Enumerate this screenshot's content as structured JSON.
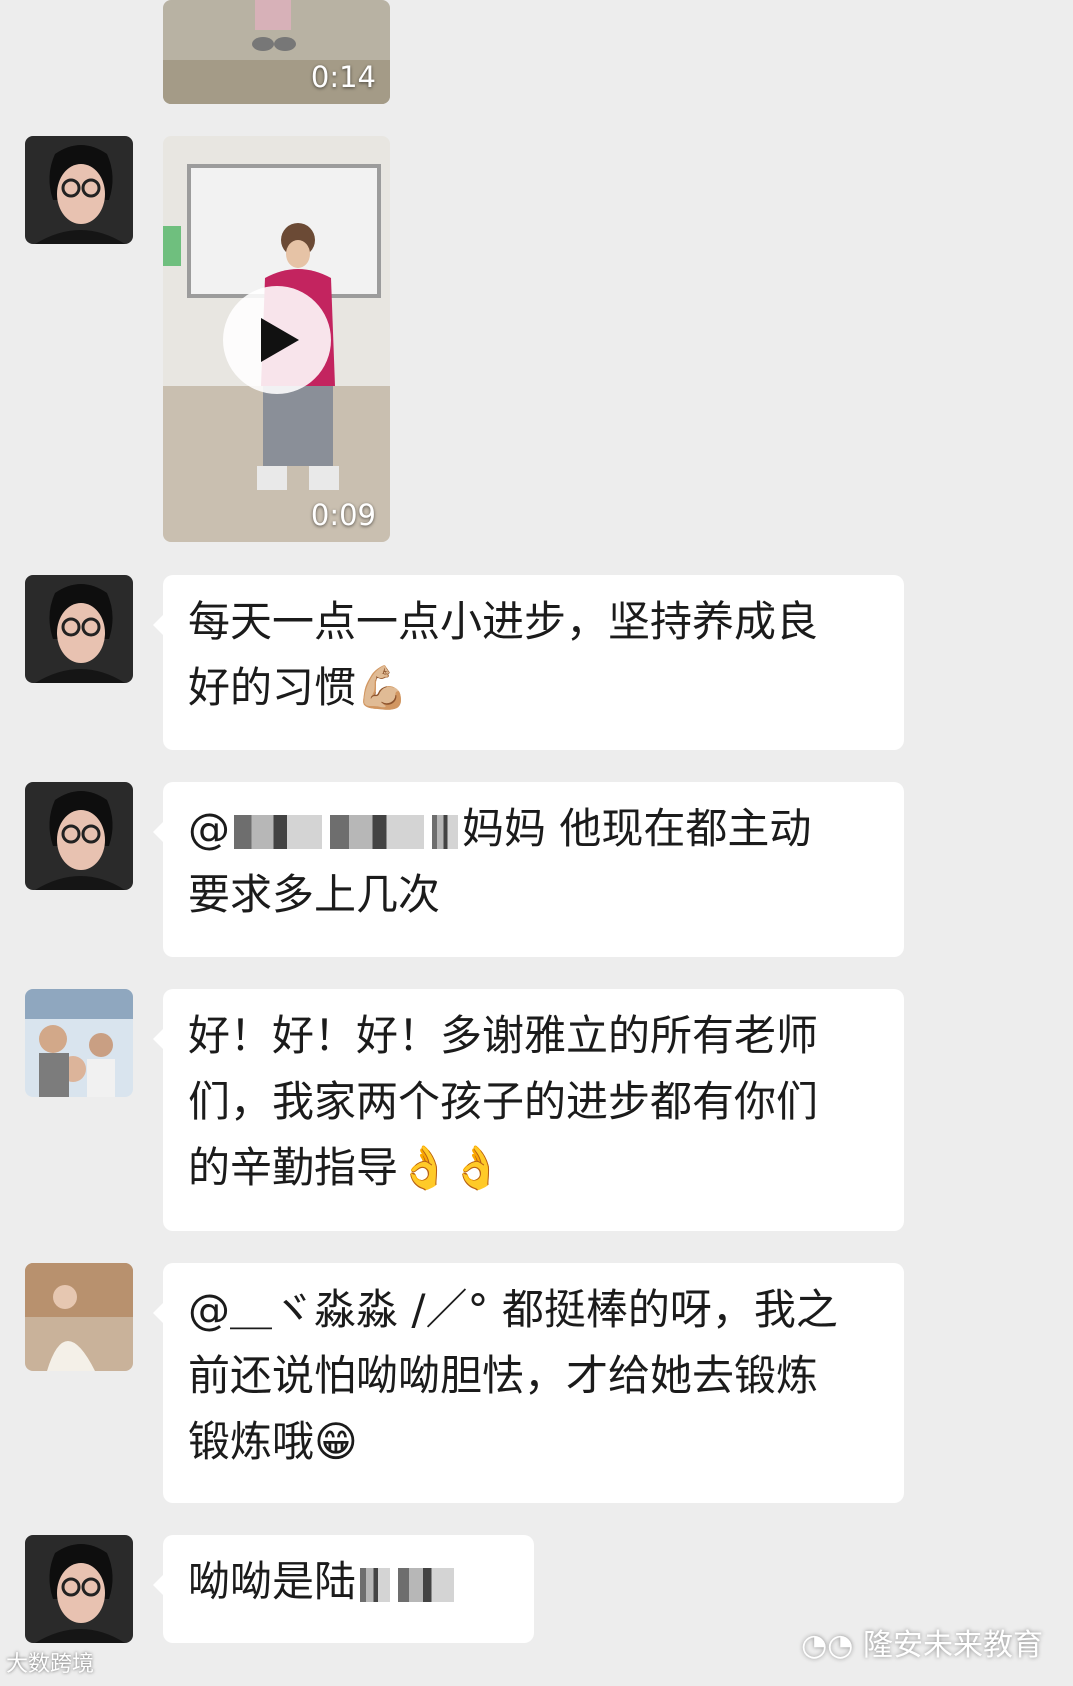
{
  "messages": [
    {
      "type": "video",
      "duration": "0:14"
    },
    {
      "type": "video",
      "duration": "0:09"
    },
    {
      "type": "text",
      "lines": [
        "每天一点一点小进步，坚持养成良",
        "好的习惯💪🏼"
      ]
    },
    {
      "type": "text",
      "lines": [
        "@",
        "妈妈  他现在都主动",
        "要求多上几次"
      ]
    },
    {
      "type": "text",
      "lines": [
        "好！好！好！多谢雅立的所有老师",
        "们，我家两个孩子的进步都有你们",
        "的辛勤指导👌👌"
      ]
    },
    {
      "type": "text",
      "lines": [
        "@＿ヾ淼淼 /／° 都挺棒的呀，我之",
        "前还说怕呦呦胆怯，才给她去锻炼",
        "锻炼哦😁"
      ]
    },
    {
      "type": "text",
      "lines": [
        "呦呦是陆"
      ]
    }
  ],
  "watermarks": {
    "left": "大数跨境",
    "right": "隆安未来教育"
  },
  "icons": [
    "play-icon",
    "wechat-icon"
  ]
}
